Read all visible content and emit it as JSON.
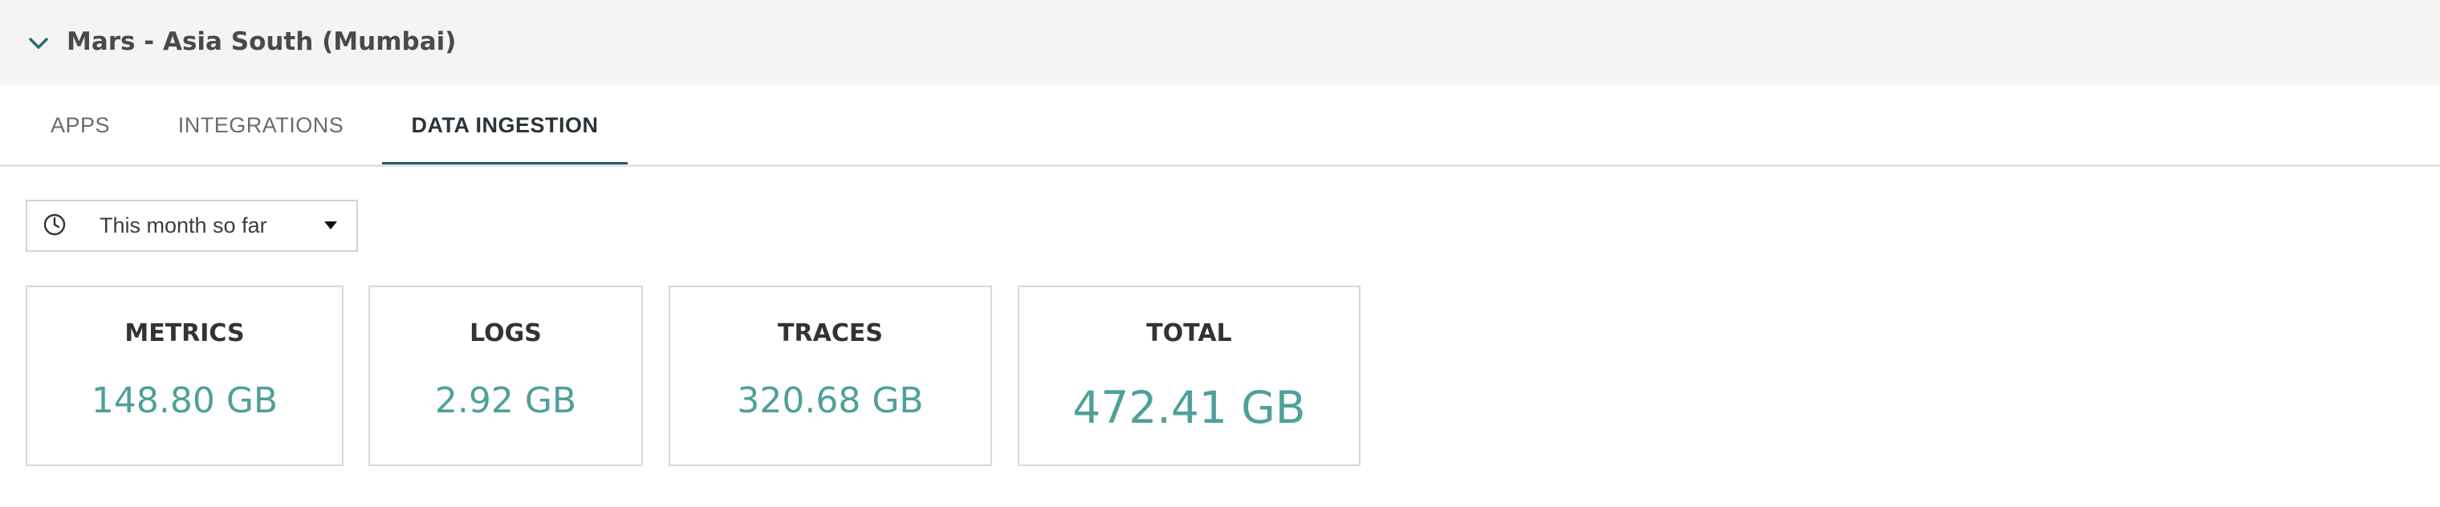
{
  "header": {
    "title": "Mars - Asia South (Mumbai)",
    "collapse_icon": "chevron-down-icon"
  },
  "tabs": [
    {
      "label": "APPS",
      "active": false
    },
    {
      "label": "INTEGRATIONS",
      "active": false
    },
    {
      "label": "DATA INGESTION",
      "active": true
    }
  ],
  "time_range": {
    "icon": "clock-icon",
    "selected": "This month so far",
    "caret_icon": "caret-down-icon"
  },
  "cards": [
    {
      "title": "METRICS",
      "value": "148.80 GB"
    },
    {
      "title": "LOGS",
      "value": "2.92 GB"
    },
    {
      "title": "TRACES",
      "value": "320.68 GB"
    },
    {
      "title": "TOTAL",
      "value": "472.41 GB"
    }
  ],
  "colors": {
    "accent": "#245a5c",
    "value_teal": "#4fa09a",
    "header_bg": "#f4f4f4"
  }
}
